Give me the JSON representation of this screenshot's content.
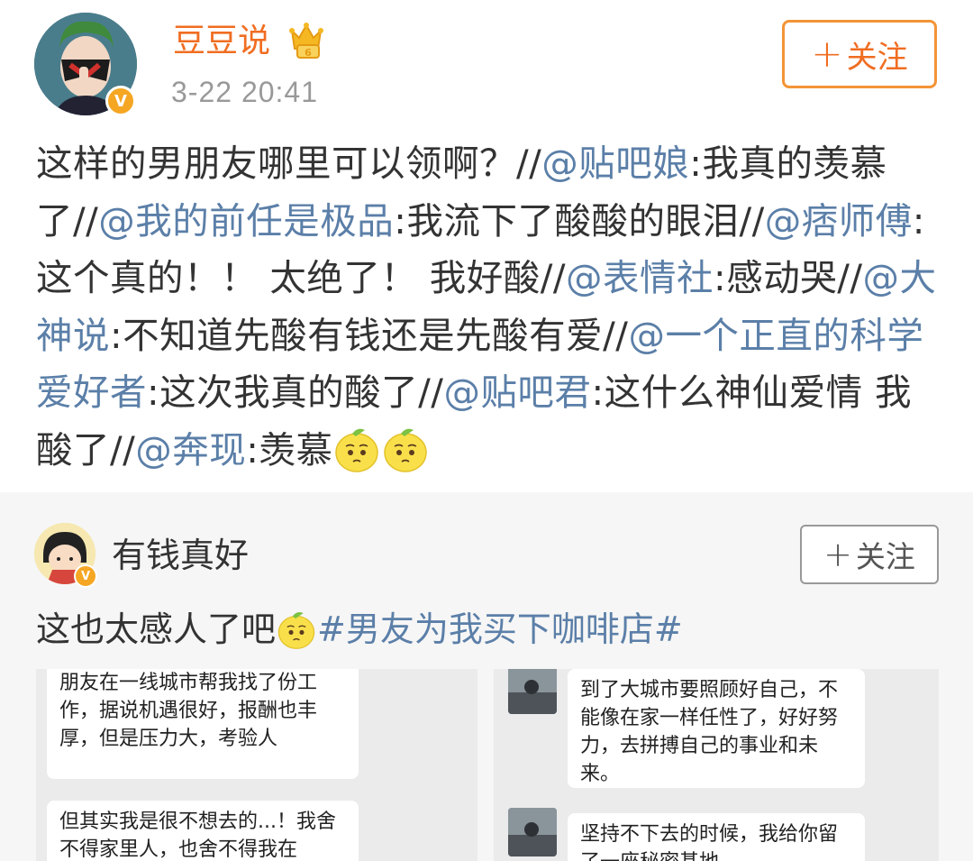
{
  "post": {
    "username": "豆豆说",
    "timestamp": "3-22 20:41",
    "follow_label": "关注",
    "follow_plus": "+",
    "verified_icon": "v-badge-icon",
    "crown_icon": "crown-icon",
    "segments": [
      "这样的男朋友哪里可以领啊？//",
      "@贴吧娘",
      ":我真的羡慕了//",
      "@我的前任是极品",
      ":我流下了酸酸的眼泪//",
      "@痞师傅",
      ":这个真的！！ 太绝了！ 我好酸//",
      "@表情社",
      ":感动哭//",
      "@大神说",
      ":不知道先酸有钱还是先酸有爱//",
      "@一个正直的科学爱好者",
      ":这次我真的酸了//",
      "@贴吧君",
      ":这什么神仙爱情 我酸了//",
      "@奔现",
      ":羡慕"
    ],
    "emoji": [
      "lemon-icon",
      "lemon-icon"
    ]
  },
  "retweet": {
    "username": "有钱真好",
    "follow_label": "关注",
    "follow_plus": "+",
    "text": "这也太感人了吧",
    "emoji": "lemon-icon",
    "hashtag": "#男友为我买下咖啡店#",
    "chat_left": [
      "朋友在一线城市帮我找了份工作，据说机遇很好，报酬也丰厚，但是压力大，考验人",
      "但其实我是很不想去的...！我舍不得家里人，也舍不得我在"
    ],
    "chat_right": [
      "到了大城市要照顾好自己，不能像在家一样任性了，好好努力，去拼搏自己的事业和未来。",
      "坚持不下去的时候，我给你留了一座秘密基地"
    ]
  },
  "colors": {
    "username_orange": "#f06d21",
    "follow_border": "#f39436",
    "mention_blue": "#5b7fa8",
    "timestamp_gray": "#999999",
    "retweet_bg": "#f6f6f6"
  }
}
